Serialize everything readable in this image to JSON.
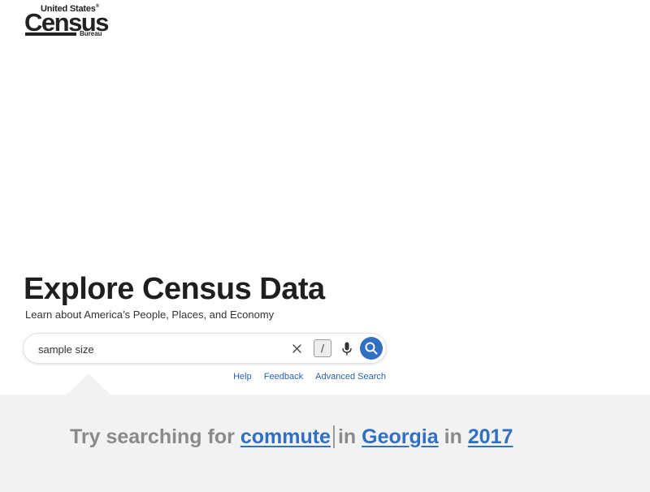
{
  "logo": {
    "top_text": "United States",
    "registered": "®",
    "main_text": "Census",
    "bottom_text": "Bureau"
  },
  "hero": {
    "title": "Explore Census Data",
    "subtitle": "Learn about America’s People, Places, and Economy"
  },
  "search": {
    "value": "sample size",
    "placeholder": "",
    "shortcut_key": "/",
    "icons": {
      "clear": "close-icon",
      "voice": "microphone-icon",
      "submit": "search-icon"
    },
    "accent_color": "#2f6fc4"
  },
  "links": {
    "help": "Help",
    "feedback": "Feedback",
    "advanced": "Advanced Search"
  },
  "suggestion": {
    "prefix": "Try searching for",
    "topic": "commute",
    "in1": "in",
    "place": "Georgia",
    "in2": "in",
    "year": "2017"
  }
}
